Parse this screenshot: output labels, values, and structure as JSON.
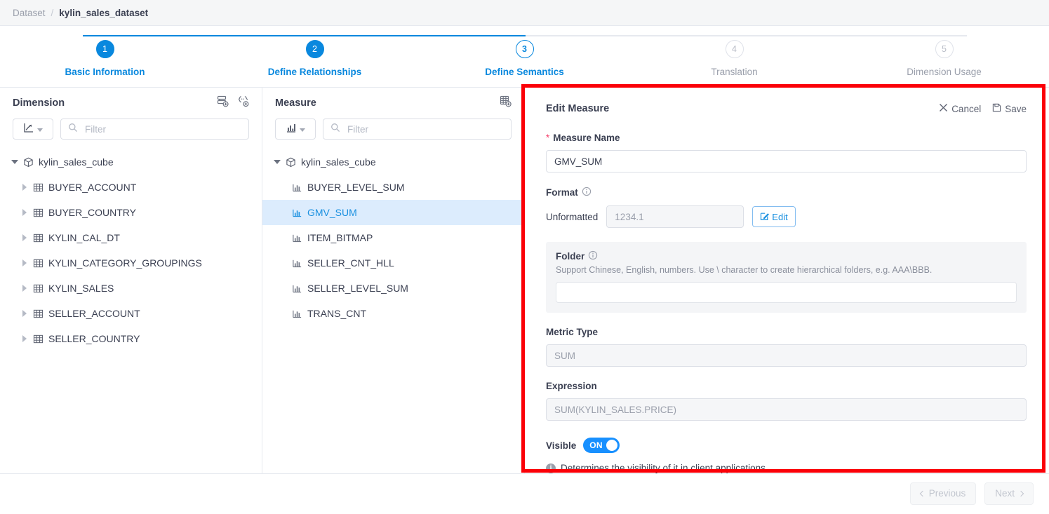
{
  "breadcrumb": {
    "root": "Dataset",
    "separator": "/",
    "current": "kylin_sales_dataset"
  },
  "stepper": {
    "steps": [
      {
        "num": "1",
        "label": "Basic Information",
        "state": "done"
      },
      {
        "num": "2",
        "label": "Define Relationships",
        "state": "done"
      },
      {
        "num": "3",
        "label": "Define Semantics",
        "state": "active"
      },
      {
        "num": "4",
        "label": "Translation",
        "state": "todo"
      },
      {
        "num": "5",
        "label": "Dimension Usage",
        "state": "todo"
      }
    ]
  },
  "dimension_panel": {
    "title": "Dimension",
    "icons": [
      {
        "name": "add-named-set-icon"
      },
      {
        "name": "add-calculated-member-icon"
      }
    ],
    "type_filter_icon": "line-chart-icon",
    "filter_placeholder": "Filter",
    "filter_value": "",
    "tree": {
      "root": {
        "label": "kylin_sales_cube",
        "icon": "cube-icon",
        "expanded": true
      },
      "children": [
        {
          "label": "BUYER_ACCOUNT",
          "icon": "table-icon"
        },
        {
          "label": "BUYER_COUNTRY",
          "icon": "table-icon"
        },
        {
          "label": "KYLIN_CAL_DT",
          "icon": "table-icon"
        },
        {
          "label": "KYLIN_CATEGORY_GROUPINGS",
          "icon": "table-icon"
        },
        {
          "label": "KYLIN_SALES",
          "icon": "table-icon"
        },
        {
          "label": "SELLER_ACCOUNT",
          "icon": "table-icon"
        },
        {
          "label": "SELLER_COUNTRY",
          "icon": "table-icon"
        }
      ]
    }
  },
  "measure_panel": {
    "title": "Measure",
    "icons": [
      {
        "name": "add-measure-icon"
      }
    ],
    "type_filter_icon": "bar-chart-icon",
    "filter_placeholder": "Filter",
    "filter_value": "",
    "tree": {
      "root": {
        "label": "kylin_sales_cube",
        "icon": "cube-icon",
        "expanded": true
      },
      "children": [
        {
          "label": "BUYER_LEVEL_SUM",
          "icon": "measure-icon",
          "selected": false
        },
        {
          "label": "GMV_SUM",
          "icon": "measure-icon",
          "selected": true
        },
        {
          "label": "ITEM_BITMAP",
          "icon": "measure-icon",
          "selected": false
        },
        {
          "label": "SELLER_CNT_HLL",
          "icon": "measure-icon",
          "selected": false
        },
        {
          "label": "SELLER_LEVEL_SUM",
          "icon": "measure-icon",
          "selected": false
        },
        {
          "label": "TRANS_CNT",
          "icon": "measure-icon",
          "selected": false
        }
      ]
    }
  },
  "edit_measure": {
    "title": "Edit Measure",
    "cancel_label": "Cancel",
    "save_label": "Save",
    "measure_name": {
      "label": "Measure Name",
      "required_mark": "*",
      "value": "GMV_SUM",
      "placeholder": ""
    },
    "format": {
      "label": "Format",
      "info_icon": "info-circle-icon",
      "type_label": "Unformatted",
      "sample_value": "",
      "sample_placeholder": "1234.1",
      "edit_button_label": "Edit"
    },
    "folder": {
      "label": "Folder",
      "info_icon": "info-circle-icon",
      "hint": "Support Chinese, English, numbers. Use \\ character to create hierarchical folders, e.g. AAA\\BBB.",
      "value": "",
      "placeholder": ""
    },
    "metric_type": {
      "label": "Metric Type",
      "value": "",
      "placeholder": "SUM"
    },
    "expression": {
      "label": "Expression",
      "value": "",
      "placeholder": "SUM(KYLIN_SALES.PRICE)"
    },
    "visible": {
      "label": "Visible",
      "state_label": "ON",
      "enabled": true,
      "note": "Determines the visibility of it in client applications."
    }
  },
  "footer": {
    "previous_label": "Previous",
    "next_label": "Next",
    "previous_disabled": true,
    "next_disabled": true
  },
  "colors": {
    "accent": "#0988de",
    "selected_row": "#dcecfd",
    "toggle_on": "#1890ff",
    "highlight_border": "#fb0007",
    "required_star": "#f5426c",
    "text": "#3a3f51",
    "muted": "#9a9fab"
  }
}
